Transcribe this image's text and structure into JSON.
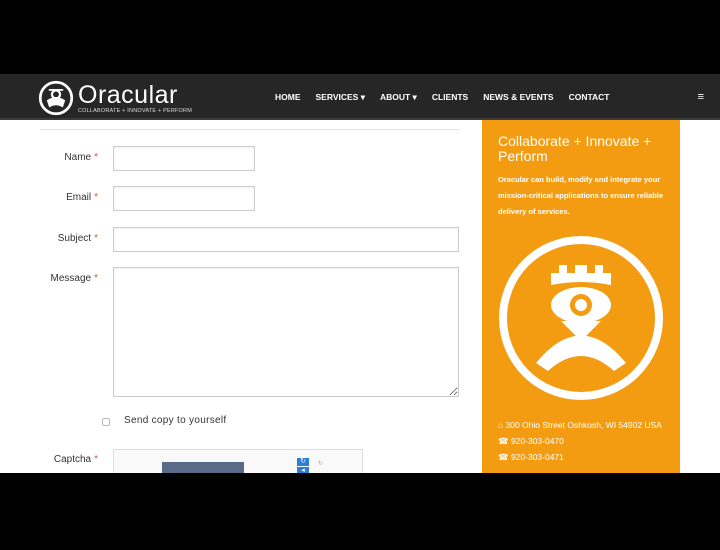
{
  "brand": {
    "name": "Oracular",
    "tagline": "COLLABORATE + INNOVATE + PERFORM"
  },
  "nav": {
    "items": [
      {
        "label": "HOME"
      },
      {
        "label": "SERVICES ▾"
      },
      {
        "label": "ABOUT ▾"
      },
      {
        "label": "CLIENTS"
      },
      {
        "label": "NEWS & EVENTS"
      },
      {
        "label": "CONTACT"
      }
    ],
    "menu_icon": "≡"
  },
  "form": {
    "name_label": "Name",
    "email_label": "Email",
    "subject_label": "Subject",
    "message_label": "Message",
    "captcha_label": "Captcha",
    "required_mark": "*",
    "copy_label": "Send copy to yourself",
    "name_value": "",
    "email_value": "",
    "subject_value": "",
    "message_value": ""
  },
  "sidebar": {
    "heading": "Collaborate + Innovate + Perform",
    "body": "Oracular can build, modify and integrate your mission-critical applications to ensure reliable delivery of services.",
    "address": "300 Ohio Street Oshkosh, WI 54902 USA",
    "phone1": "920-303-0470",
    "phone2": "920-303-0471",
    "accent": "#f39c12"
  }
}
